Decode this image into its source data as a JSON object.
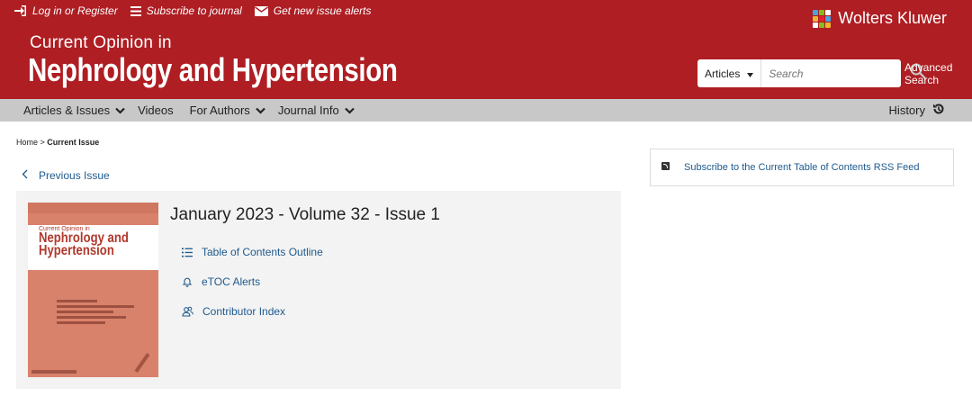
{
  "colors": {
    "brand_red": "#ae1e23",
    "nav_gray": "#c8c8c8",
    "link_blue": "#1e5a8e",
    "panel_gray": "#f3f3f3"
  },
  "top_links": {
    "login": "Log in or Register",
    "subscribe": "Subscribe to journal",
    "alerts": "Get new issue alerts"
  },
  "journal": {
    "subtitle": "Current Opinion in",
    "title": "Nephrology and Hypertension"
  },
  "publisher": {
    "name": "Wolters Kluwer"
  },
  "search": {
    "scope": "Articles",
    "placeholder": "Search",
    "advanced_line1": "Advanced",
    "advanced_line2": "Search"
  },
  "nav": {
    "items": [
      {
        "label": "Articles & Issues",
        "dropdown": true
      },
      {
        "label": "Videos",
        "dropdown": false
      },
      {
        "label": "For Authors",
        "dropdown": true
      },
      {
        "label": "Journal Info",
        "dropdown": true
      }
    ],
    "history": "History"
  },
  "breadcrumb": {
    "home": "Home",
    "separator": " > ",
    "current": "Current Issue"
  },
  "previous_issue": "Previous Issue",
  "issue": {
    "title": "January 2023 - Volume 32 - Issue 1",
    "links": [
      {
        "label": "Table of Contents Outline",
        "icon": "list-icon"
      },
      {
        "label": "eTOC Alerts",
        "icon": "bell-icon"
      },
      {
        "label": "Contributor Index",
        "icon": "contributors-icon"
      }
    ]
  },
  "cover": {
    "line1": "Current Opinion in",
    "line2": "Nephrology and",
    "line3": "Hypertension"
  },
  "rss": {
    "label": "Subscribe to the Current Table of Contents RSS Feed"
  }
}
